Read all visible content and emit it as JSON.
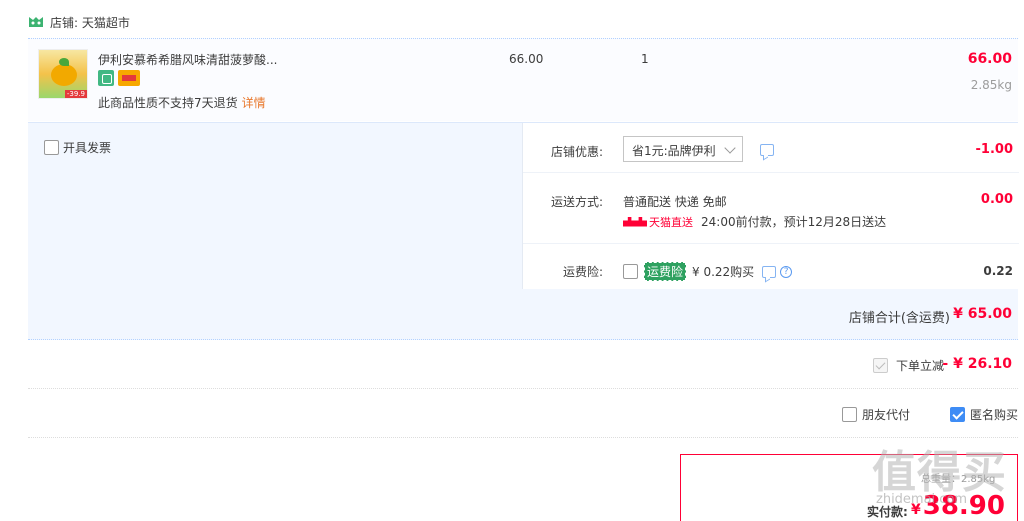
{
  "shop": {
    "label": "店铺: 天猫超市"
  },
  "item": {
    "title": "伊利安慕希希腊风味清甜菠萝酸...",
    "return_note": "此商品性质不支持7天退货",
    "detail_link": "详情",
    "unit_price": "66.00",
    "quantity": "1",
    "subtotal": "66.00",
    "weight": "2.85kg",
    "thumb_tag": "-39.9"
  },
  "invoice": {
    "label": "开具发票",
    "checked": false
  },
  "shop_discount": {
    "label": "店铺优惠:",
    "selected": "省1元:品牌伊利",
    "amount": "-1.00"
  },
  "shipping": {
    "label": "运送方式:",
    "method": "普通配送 快递 免邮",
    "carrier": "天猫直送",
    "eta": "24:00前付款，预计12月28日送达",
    "amount": "0.00"
  },
  "insurance": {
    "label": "运费险:",
    "badge": "运费险",
    "price": "¥ 0.22购买",
    "amount": "0.22",
    "help": "?"
  },
  "shop_total": {
    "label": "店铺合计(含运费)",
    "value": "¥ 65.00"
  },
  "instant_discount": {
    "label": "下单立减",
    "value": "- ¥ 26.10"
  },
  "pay_options": {
    "friend_pay": "朋友代付",
    "anonymous": "匿名购买"
  },
  "payment": {
    "ghost_text": "总重量：2.85kg",
    "actual_label": "实付款:",
    "currency": "¥",
    "actual_value": "38.90"
  },
  "watermark": {
    "main": "值得买",
    "sub": "zhidemai.com"
  },
  "colors": {
    "accent": "#ff0036",
    "panel": "#f2f7ff",
    "checkbox": "#3e8cf5"
  }
}
